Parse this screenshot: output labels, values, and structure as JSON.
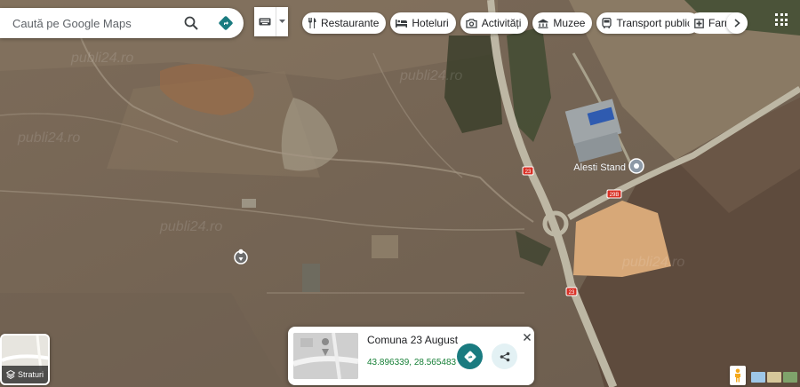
{
  "search": {
    "placeholder": "Caută pe Google Maps"
  },
  "chips": [
    {
      "label": "Restaurante",
      "icon": "fork-knife-icon"
    },
    {
      "label": "Hoteluri",
      "icon": "bed-icon"
    },
    {
      "label": "Activități",
      "icon": "camera-icon"
    },
    {
      "label": "Muzee",
      "icon": "museum-icon"
    },
    {
      "label": "Transport public",
      "icon": "bus-icon"
    },
    {
      "label": "Farm",
      "icon": "pharmacy-icon"
    }
  ],
  "map": {
    "place_label": "Alesti Stand",
    "road_shields": [
      "23",
      "29B",
      "23"
    ]
  },
  "layers": {
    "label": "Straturi"
  },
  "info_card": {
    "title": "Comuna 23 August",
    "coordinates": "43.896339, 28.565483"
  },
  "colors": {
    "accent": "#1a7b80",
    "coords_green": "#188038",
    "road": "#bdb7a4",
    "shield": "#d93025"
  }
}
